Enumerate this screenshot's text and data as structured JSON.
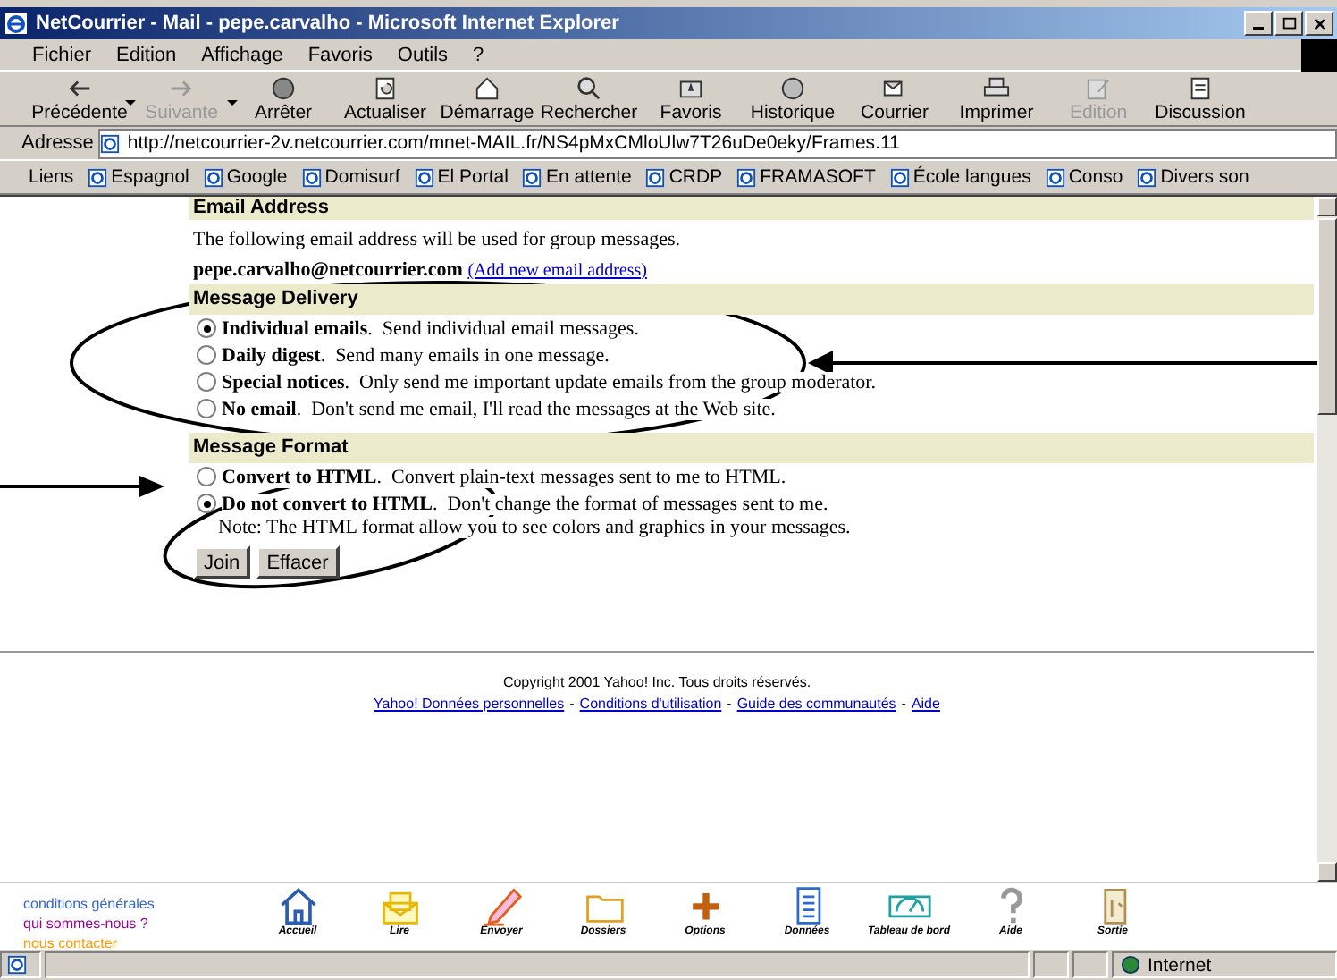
{
  "window": {
    "title": "NetCourrier - Mail - pepe.carvalho - Microsoft Internet Explorer"
  },
  "menu": [
    "Fichier",
    "Edition",
    "Affichage",
    "Favoris",
    "Outils",
    "?"
  ],
  "toolbar": [
    {
      "kind": "back",
      "label": "Précédente",
      "disabled": false,
      "dropdown": true
    },
    {
      "kind": "forward",
      "label": "Suivante",
      "disabled": true,
      "dropdown": true
    },
    {
      "kind": "stop",
      "label": "Arrêter",
      "disabled": false,
      "dropdown": false
    },
    {
      "kind": "refresh",
      "label": "Actualiser",
      "disabled": false,
      "dropdown": false
    },
    {
      "kind": "home",
      "label": "Démarrage",
      "disabled": false,
      "dropdown": false
    },
    {
      "kind": "search",
      "label": "Rechercher",
      "disabled": false,
      "dropdown": false
    },
    {
      "kind": "favorites",
      "label": "Favoris",
      "disabled": false,
      "dropdown": false
    },
    {
      "kind": "history",
      "label": "Historique",
      "disabled": false,
      "dropdown": false
    },
    {
      "kind": "mail",
      "label": "Courrier",
      "disabled": false,
      "dropdown": false
    },
    {
      "kind": "print",
      "label": "Imprimer",
      "disabled": false,
      "dropdown": false
    },
    {
      "kind": "edit",
      "label": "Edition",
      "disabled": true,
      "dropdown": false
    },
    {
      "kind": "discuss",
      "label": "Discussion",
      "disabled": false,
      "dropdown": false
    }
  ],
  "address": {
    "label": "Adresse",
    "value": "http://netcourrier-2v.netcourrier.com/mnet-MAIL.fr/NS4pMxCMloUlw7T26uDe0eky/Frames.11"
  },
  "links": {
    "label": "Liens",
    "items": [
      "Espagnol",
      "Google",
      "Domisurf",
      "El Portal",
      "En attente",
      "CRDP",
      "FRAMASOFT",
      "École  langues",
      "Conso",
      "Divers son"
    ]
  },
  "email_section": {
    "heading": "Email Address",
    "text": "The following email address will be used for group messages.",
    "email": "pepe.carvalho@netcourrier.com",
    "link": "(Add new email address)"
  },
  "delivery": {
    "heading": "Message Delivery",
    "options": [
      {
        "text": "**Individual emails**.  Send individual email messages.",
        "selected": true
      },
      {
        "text": "**Daily digest**.  Send many emails in one message.",
        "selected": false
      },
      {
        "text": "**Special notices**.  Only send me important update emails from the group moderator.",
        "selected": false
      },
      {
        "text": "**No email**.  Don't send me email, I'll read the messages at the Web site.",
        "selected": false
      }
    ]
  },
  "format": {
    "heading": "Message Format",
    "options": [
      {
        "text": "**Convert to HTML**.  Convert plain-text messages sent to me to HTML.",
        "selected": false
      },
      {
        "text": "**Do not convert to HTML**.  Don't change the format of messages sent to me.",
        "selected": true
      }
    ],
    "note": "Note: The HTML format allow you to see colors and graphics in your messages."
  },
  "buttons": [
    "Join",
    "Effacer"
  ],
  "footer": {
    "copyright": "Copyright 2001 Yahoo! Inc. Tous droits réservés.",
    "links": [
      {
        "kind": "link",
        "text": "Yahoo! Données personnelles"
      },
      {
        "kind": "separator",
        "text": "-"
      },
      {
        "kind": "link",
        "text": "Conditions d'utilisation"
      },
      {
        "kind": "separator",
        "text": "-"
      },
      {
        "kind": "link",
        "text": "Guide des communautés"
      },
      {
        "kind": "separator",
        "text": "-"
      },
      {
        "kind": "link",
        "text": "Aide"
      }
    ]
  },
  "bottom_links": [
    {
      "label": "conditions générales",
      "color": "#3366cc"
    },
    {
      "label": "qui sommes-nous ?",
      "color": "#990099"
    },
    {
      "label": "nous contacter",
      "color": "#ff9900"
    }
  ],
  "bottom_nav": [
    {
      "kind": "home",
      "label": "Accueil"
    },
    {
      "kind": "read",
      "label": "Lire"
    },
    {
      "kind": "write",
      "label": "Envoyer"
    },
    {
      "kind": "folders",
      "label": "Dossiers"
    },
    {
      "kind": "options",
      "label": "Options"
    },
    {
      "kind": "data",
      "label": "Données"
    },
    {
      "kind": "dashboard",
      "label": "Tableau de bord"
    },
    {
      "kind": "help",
      "label": "Aide"
    },
    {
      "kind": "exit",
      "label": "Sortie"
    }
  ],
  "status_bar": {
    "zone": "Internet"
  }
}
